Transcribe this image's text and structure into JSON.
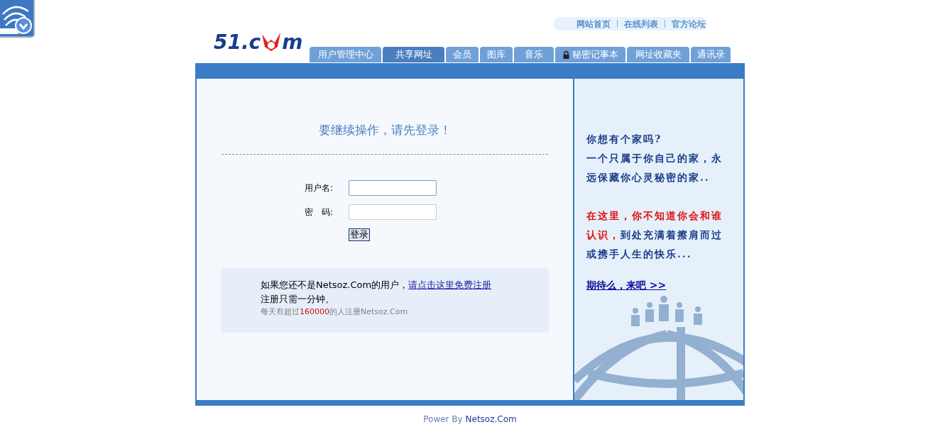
{
  "top_links": [
    "网站首页",
    "在线列表",
    "官方论坛"
  ],
  "logo": {
    "before": "51.c",
    "after": "m"
  },
  "tabs": [
    {
      "label": "用户管理中心",
      "selected": false,
      "kind": "plain"
    },
    {
      "label": "共享网址",
      "selected": true,
      "kind": "plain"
    },
    {
      "label": "会员",
      "selected": false,
      "kind": "plain"
    },
    {
      "label": "图库",
      "selected": false,
      "kind": "plain"
    },
    {
      "label": "音乐",
      "selected": false,
      "kind": "plain"
    },
    {
      "label": "秘密记事本",
      "selected": false,
      "kind": "locked"
    },
    {
      "label": "网址收藏夹",
      "selected": false,
      "kind": "plain"
    },
    {
      "label": "通讯录",
      "selected": false,
      "kind": "plain"
    }
  ],
  "login": {
    "heading": "要继续操作，请先登录！",
    "username_label": "用户名:",
    "password_label": "密　码:",
    "submit": "登录"
  },
  "register": {
    "line1": "如果您还不是Netsoz.Com的用户，",
    "link": "请点击这里免费注册",
    "line2": "注册只需一分钟。",
    "stat_before": "每天有超过",
    "stat_number": "160000",
    "stat_after": "的人注册Netsoz.Com"
  },
  "promo": {
    "paragraphs": [
      [
        {
          "text": "你想有个家吗?",
          "kind": "normal"
        }
      ],
      [
        {
          "text": "一个只属于你自己的家，永远保藏你心灵秘密的家..",
          "kind": "normal"
        }
      ],
      [
        {
          "text": "在这里，你不知道你会和谁认识，",
          "kind": "highlight"
        },
        {
          "text": "到处充满着擦肩而过或携手人生的快乐...",
          "kind": "normal"
        }
      ]
    ],
    "link": "期待么，来吧 >>"
  },
  "footer": {
    "label": "Power By",
    "link": "Netsoz.Com"
  }
}
